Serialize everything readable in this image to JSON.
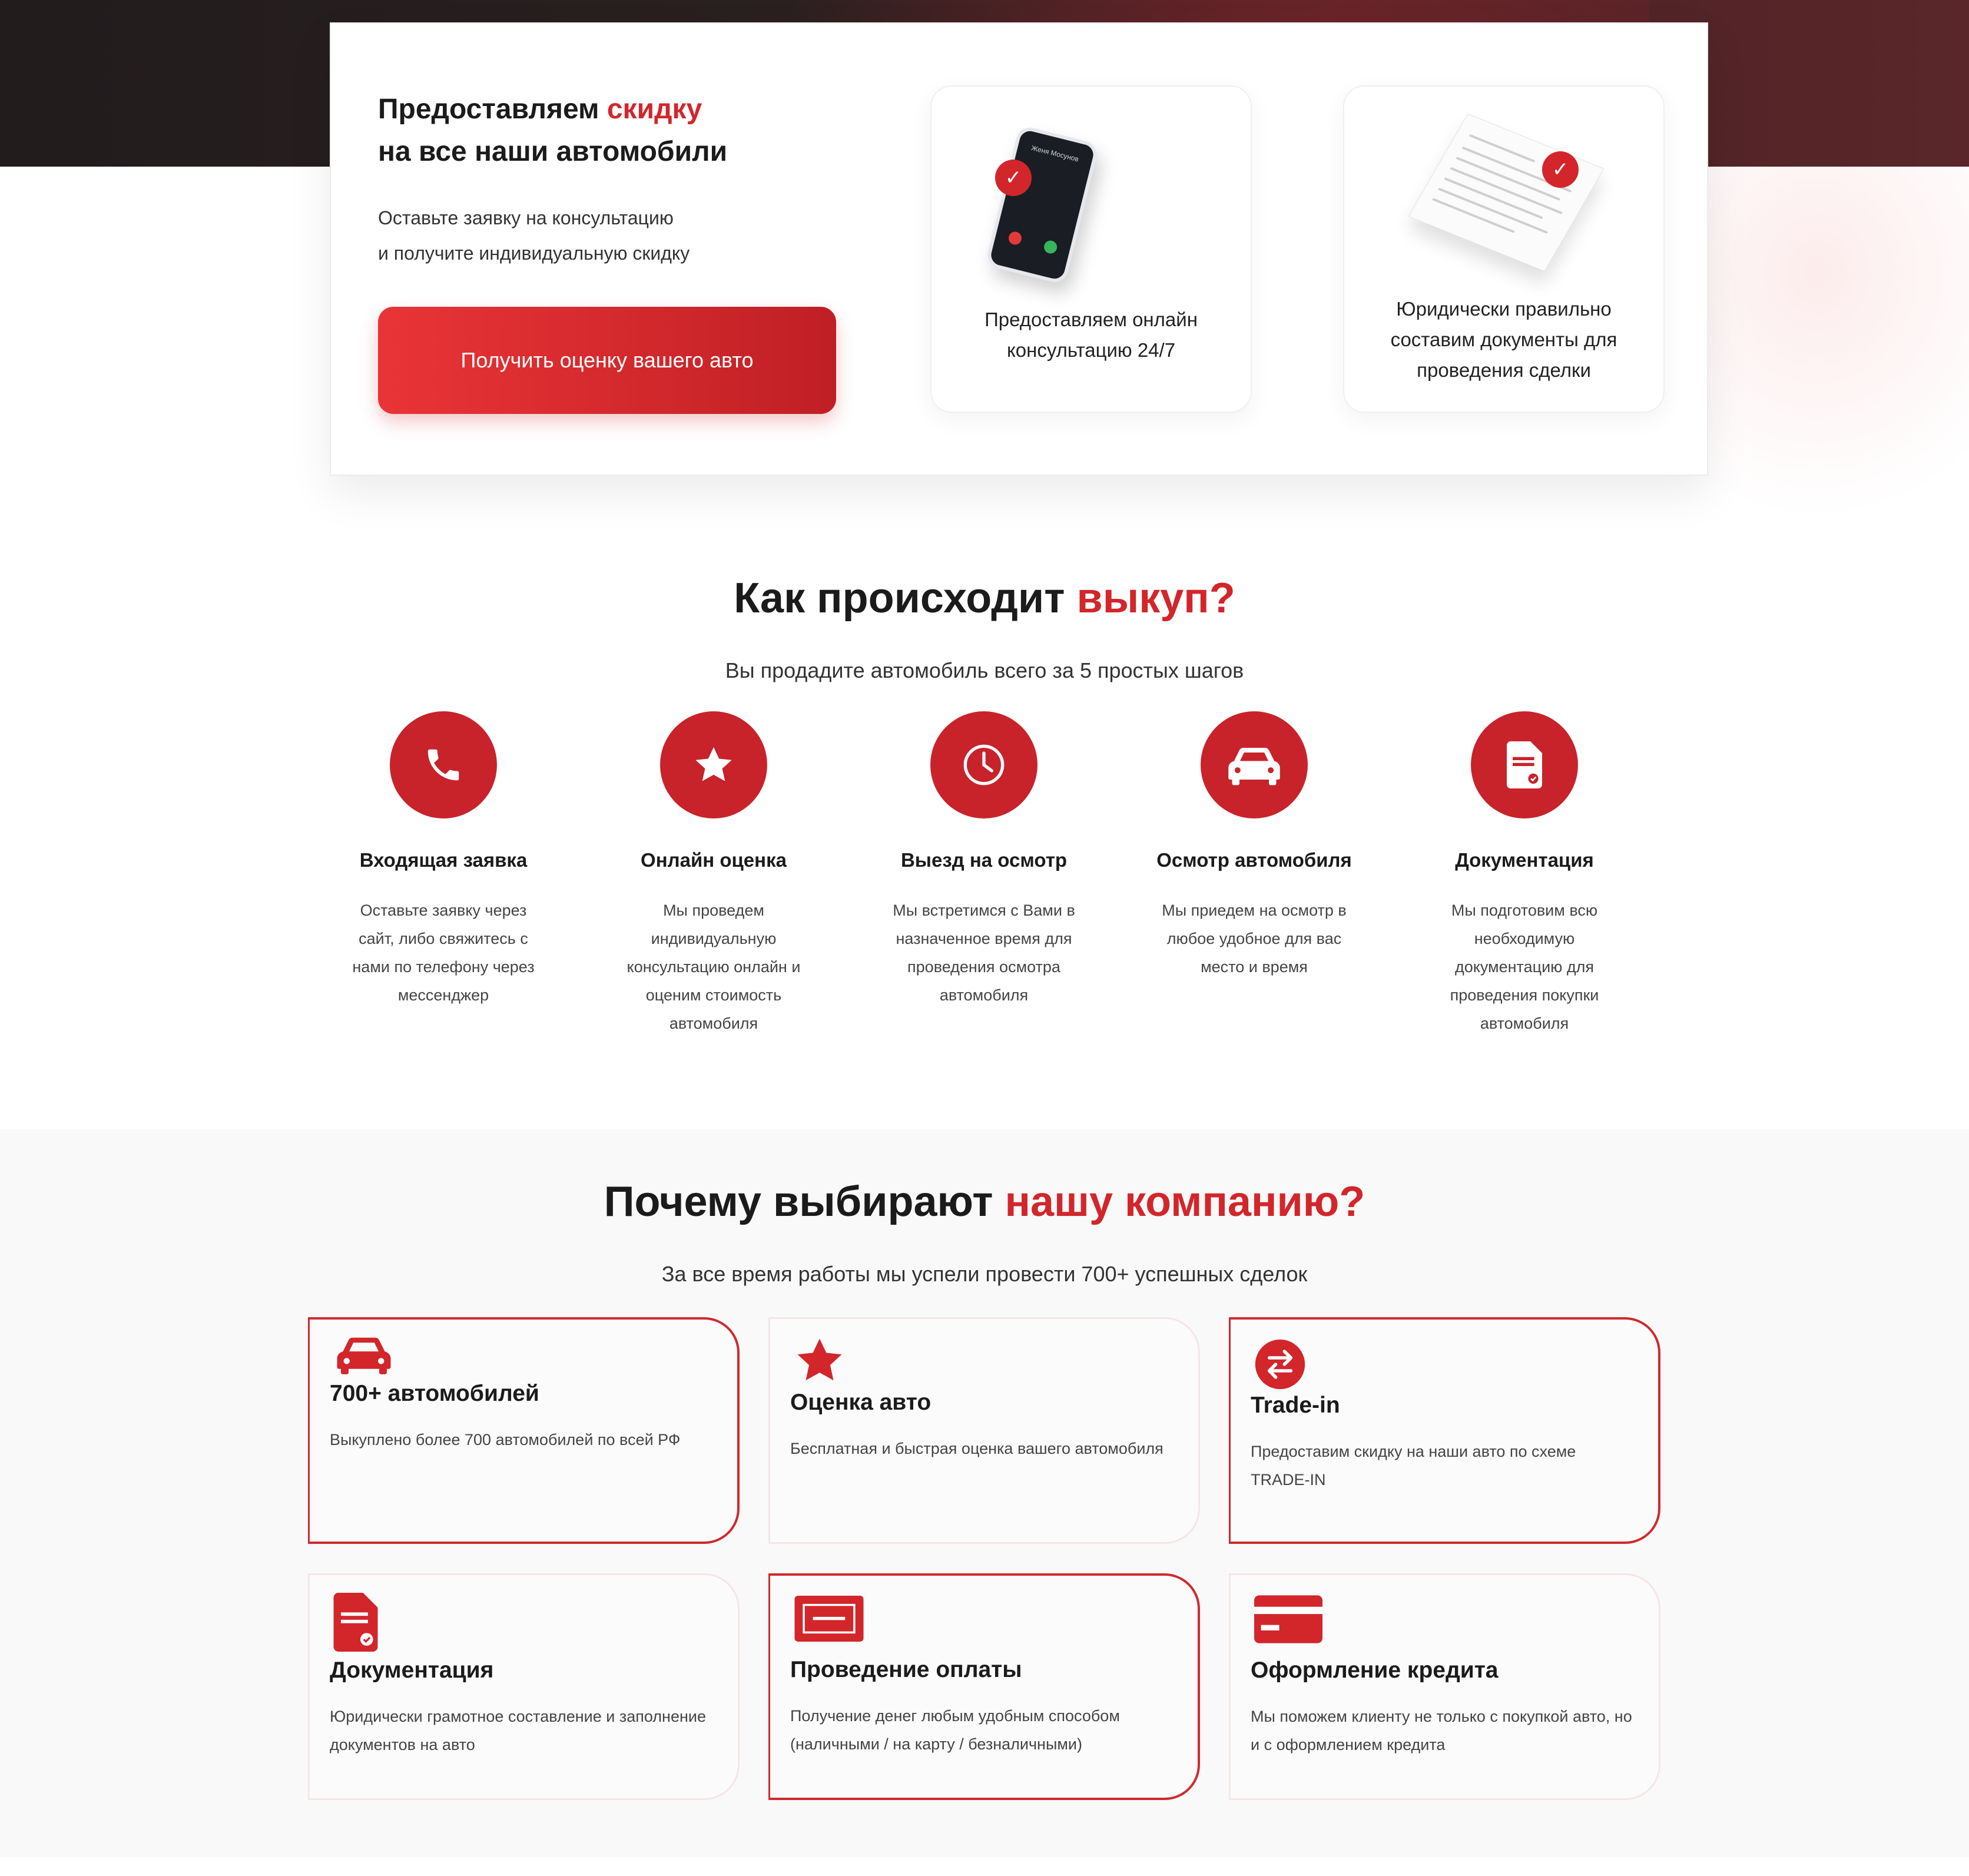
{
  "hero": {
    "title_part1": "Предоставляем ",
    "title_accent": "скидку",
    "title_part2": "на все наши автомобили",
    "subtitle_line1": "Оставьте заявку на консультацию",
    "subtitle_line2": "и получите индивидуальную скидку",
    "button_label": "Получить оценку вашего авто",
    "features": [
      {
        "text_line1": "Предоставляем онлайн",
        "text_line2": "консультацию 24/7"
      },
      {
        "text_line1": "Юридически правильно",
        "text_line2": "составим документы для",
        "text_line3": "проведения сделки"
      }
    ],
    "phone_caller": "Женя Мосунов"
  },
  "how": {
    "title_part1": "Как происходит ",
    "title_accent": "выкуп?",
    "subtitle": "Вы продадите автомобиль всего за 5 простых шагов",
    "steps": [
      {
        "icon": "phone-icon",
        "title": "Входящая заявка",
        "desc": "Оставьте заявку через сайт, либо свяжитесь с нами по телефону через мессенджер"
      },
      {
        "icon": "star-icon",
        "title": "Онлайн оценка",
        "desc": "Мы проведем индивидуальную консультацию онлайн и оценим стоимость автомобиля"
      },
      {
        "icon": "clock-icon",
        "title": "Выезд на осмотр",
        "desc": "Мы встретимся с Вами в назначенное время для проведения осмотра автомобиля"
      },
      {
        "icon": "car-icon",
        "title": "Осмотр автомобиля",
        "desc": "Мы приедем на осмотр в любое удобное для вас место и время"
      },
      {
        "icon": "document-icon",
        "title": "Документация",
        "desc": "Мы подготовим всю необходимую документацию для проведения покупки автомобиля"
      }
    ]
  },
  "why": {
    "title_part1": "Почему выбирают ",
    "title_accent": "нашу компанию?",
    "subtitle": "За все время работы мы успели провести 700+ успешных сделок",
    "cards": [
      {
        "icon": "car-icon",
        "title": "700+ автомобилей",
        "desc": "Выкуплено более 700 автомобилей по всей РФ"
      },
      {
        "icon": "star-icon",
        "title": "Оценка авто",
        "desc": "Бесплатная и быстрая оценка вашего автомобиля"
      },
      {
        "icon": "exchange-icon",
        "title": "Trade-in",
        "desc": "Предоставим скидку на наши авто по схеме TRADE-IN"
      },
      {
        "icon": "document-icon",
        "title": "Документация",
        "desc": "Юридически грамотное составление и заполнение документов на авто"
      },
      {
        "icon": "banknote-icon",
        "title": "Проведение оплаты",
        "desc": "Получение денег любым удобным способом (наличными / на карту / безналичными)"
      },
      {
        "icon": "credit-card-icon",
        "title": "Оформление кредита",
        "desc": "Мы поможем клиенту не только с покупкой авто, но и с оформлением кредита"
      }
    ]
  },
  "colors": {
    "accent": "#d2262b",
    "dark": "#221c1d"
  }
}
